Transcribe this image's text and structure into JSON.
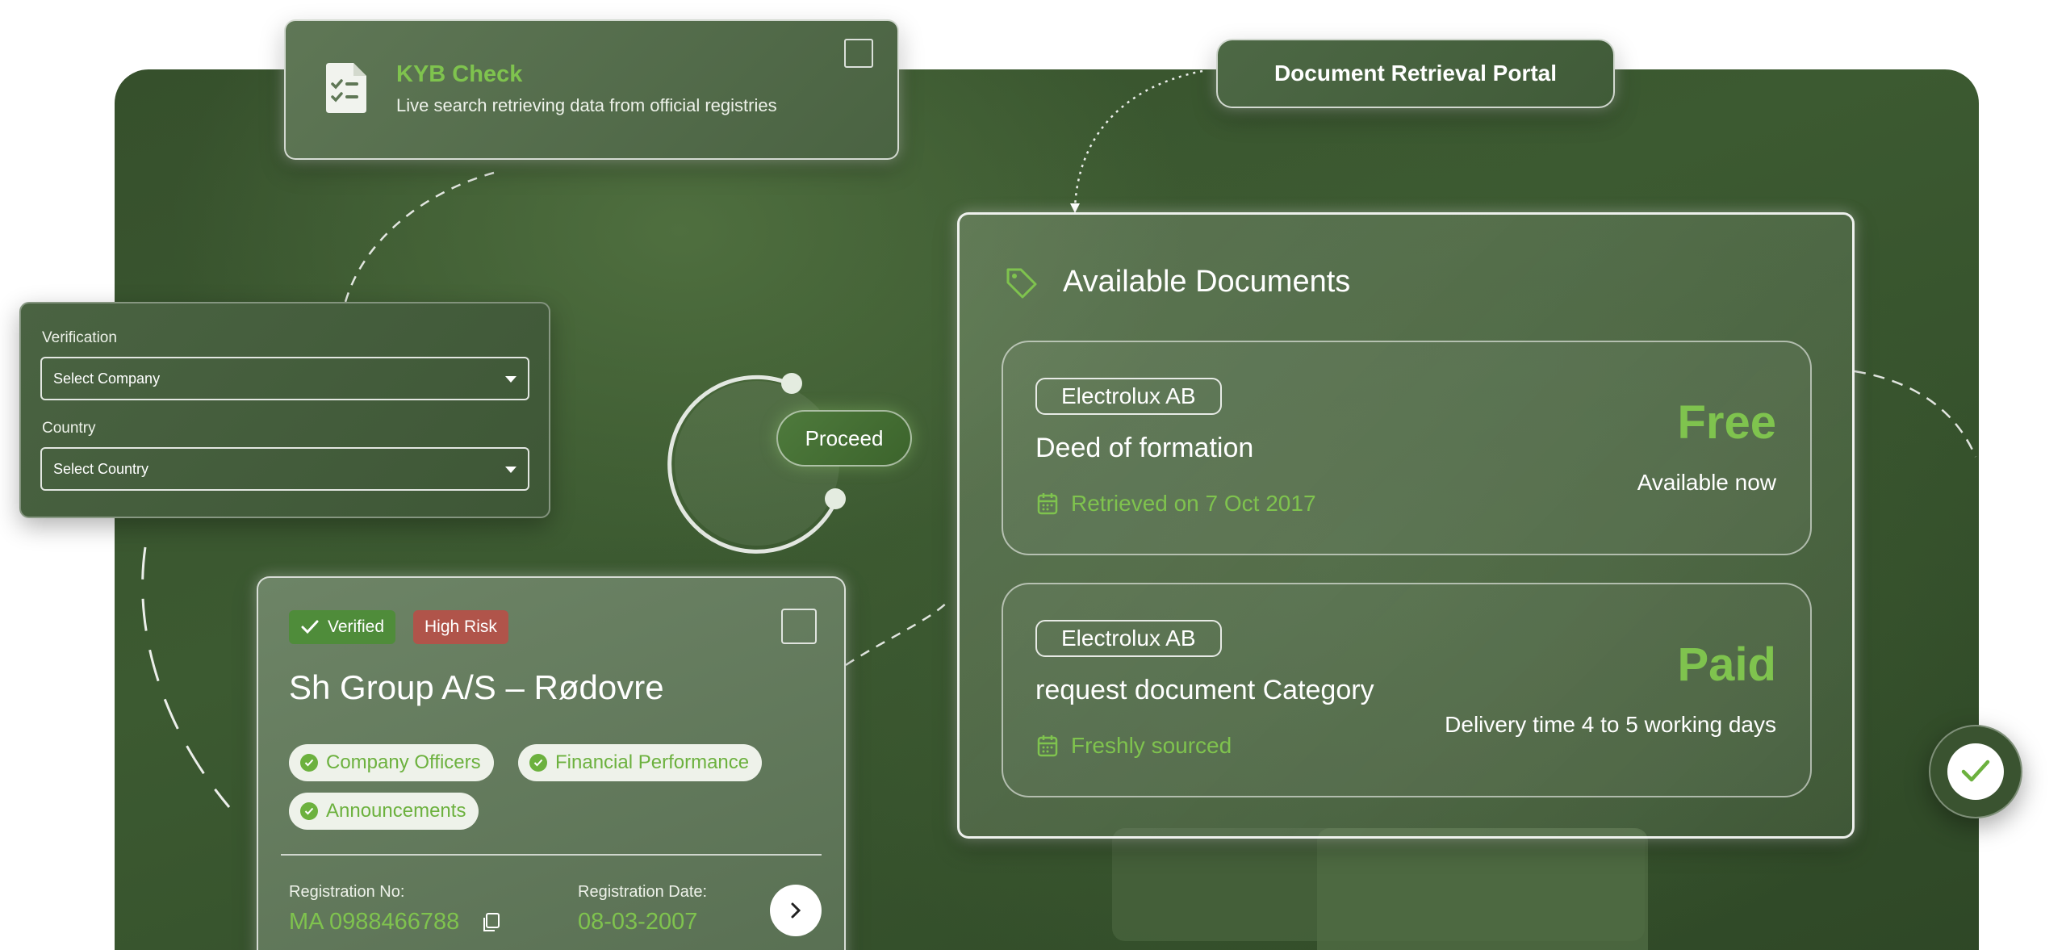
{
  "colors": {
    "accent": "#7fc34e",
    "background": "#3c5a31",
    "risk": "#b0544a",
    "verified": "#4f8c3a"
  },
  "kyb": {
    "title": "KYB Check",
    "subtitle": "Live search retrieving data from official registries",
    "icon": "checklist-document-icon"
  },
  "portal": {
    "label": "Document Retrieval Portal"
  },
  "form": {
    "verification_label": "Verification",
    "company_select": "Select Company",
    "country_label": "Country",
    "country_select": "Select Country"
  },
  "proceed": {
    "label": "Proceed"
  },
  "company_card": {
    "badges": {
      "verified": "Verified",
      "risk": "High Risk"
    },
    "name": "Sh Group A/S – Rødovre",
    "chips": [
      "Company Officers",
      "Financial Performance",
      "Announcements"
    ],
    "registration_no_label": "Registration No:",
    "registration_no": "MA 0988466788",
    "registration_date_label": "Registration Date:",
    "registration_date": "08-03-2007"
  },
  "documents": {
    "heading": "Available Documents",
    "items": [
      {
        "company": "Electrolux AB",
        "name": "Deed of formation",
        "meta": "Retrieved on 7 Oct 2017",
        "price": "Free",
        "availability": "Available now"
      },
      {
        "company": "Electrolux AB",
        "name": "request document Category",
        "meta": "Freshly sourced",
        "price": "Paid",
        "availability": "Delivery time 4 to 5 working days"
      }
    ]
  }
}
